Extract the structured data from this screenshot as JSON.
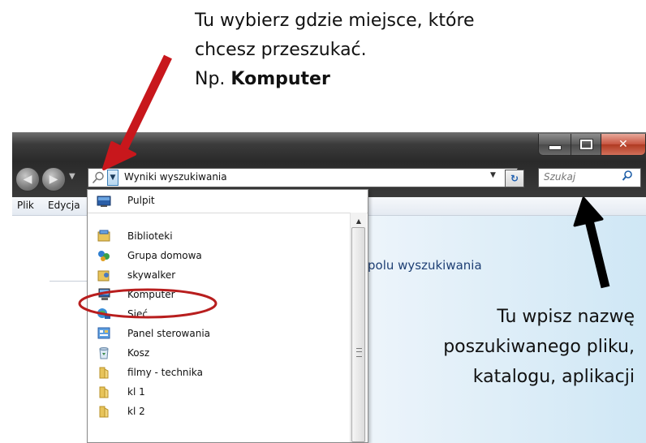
{
  "annotation_top": {
    "line1": "Tu wybierz gdzie miejsce, które",
    "line2": "chcesz przeszukać.",
    "line3_prefix": "Np. ",
    "line3_bold": "Komputer"
  },
  "annotation_right": {
    "line1": "Tu wpisz nazwę",
    "line2": "poszukiwanego pliku,",
    "line3": "katalogu, aplikacji"
  },
  "address_bar": {
    "text": "Wyniki wyszukiwania"
  },
  "search": {
    "placeholder": "Szukaj"
  },
  "menu": {
    "file": "Plik",
    "edit": "Edycja"
  },
  "content": {
    "info_text": "polu wyszukiwania"
  },
  "dropdown": {
    "pinned": {
      "label": "Pulpit",
      "icon": "desktop-icon"
    },
    "items": [
      {
        "label": "Biblioteki",
        "icon": "libraries-icon"
      },
      {
        "label": "Grupa domowa",
        "icon": "homegroup-icon"
      },
      {
        "label": "skywalker",
        "icon": "user-folder-icon"
      },
      {
        "label": "Komputer",
        "icon": "computer-icon"
      },
      {
        "label": "Sieć",
        "icon": "network-icon"
      },
      {
        "label": "Panel sterowania",
        "icon": "control-panel-icon"
      },
      {
        "label": "Kosz",
        "icon": "recycle-bin-icon"
      },
      {
        "label": "filmy - technika",
        "icon": "folder-icon"
      },
      {
        "label": "kl 1",
        "icon": "folder-icon"
      },
      {
        "label": "kl 2",
        "icon": "folder-icon"
      }
    ]
  },
  "colors": {
    "arrow_red": "#c8171c",
    "arrow_black": "#000000",
    "highlight_circle": "#b81e1e",
    "info_text": "#1e3f74"
  }
}
